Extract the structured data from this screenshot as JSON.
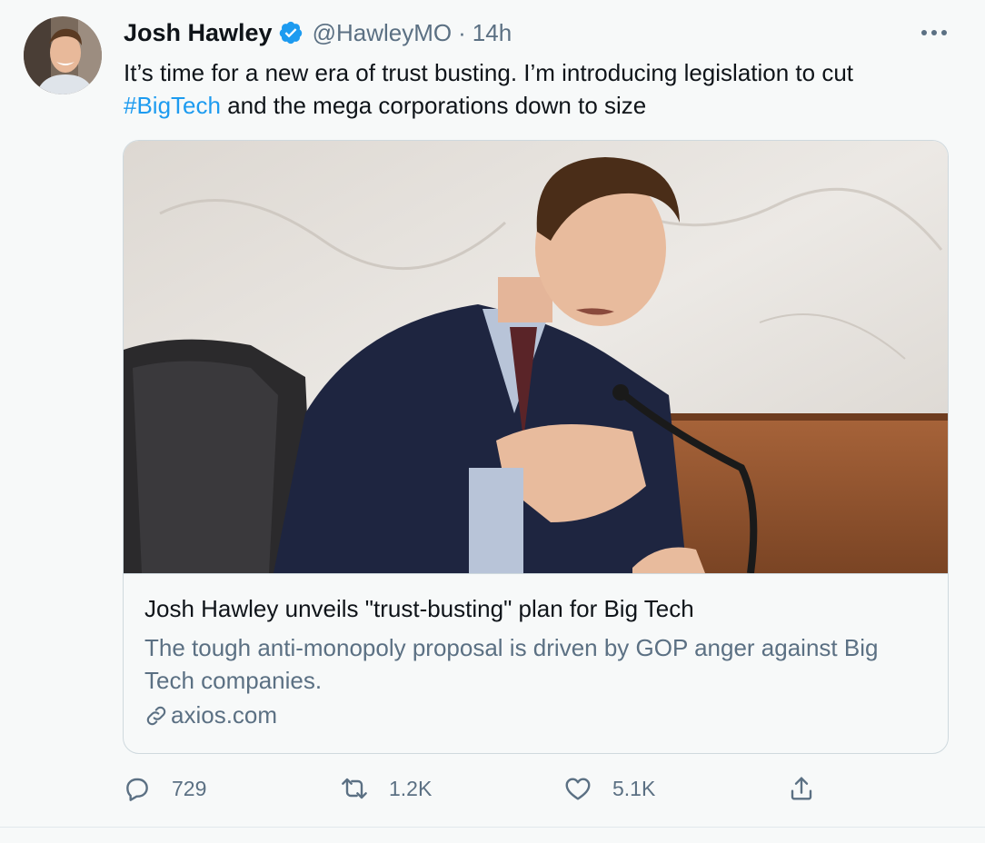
{
  "tweet": {
    "author_name": "Josh Hawley",
    "handle": "@HawleyMO",
    "separator": "·",
    "time": "14h",
    "text_before": "It’s time for a new era of trust busting. I’m introducing legislation to cut ",
    "hashtag": "#BigTech",
    "text_after": " and the mega corporations down to size",
    "icons": {
      "verified": "verified-badge-icon",
      "more": "more-options-icon"
    }
  },
  "card": {
    "title": "Josh Hawley unveils \"trust-busting\" plan for Big Tech",
    "description": "The tough anti-monopoly proposal is driven by GOP anger against Big Tech companies.",
    "domain": "axios.com",
    "link_icon": "link-icon"
  },
  "actions": {
    "reply_count": "729",
    "retweet_count": "1.2K",
    "like_count": "5.1K",
    "icons": [
      "reply-icon",
      "retweet-icon",
      "like-icon",
      "share-icon"
    ]
  },
  "colors": {
    "accent": "#1d9bf0",
    "secondary_text": "#5b7083",
    "primary_text": "#0f1419",
    "background": "#f7f9f9",
    "border": "#cfd9de"
  }
}
